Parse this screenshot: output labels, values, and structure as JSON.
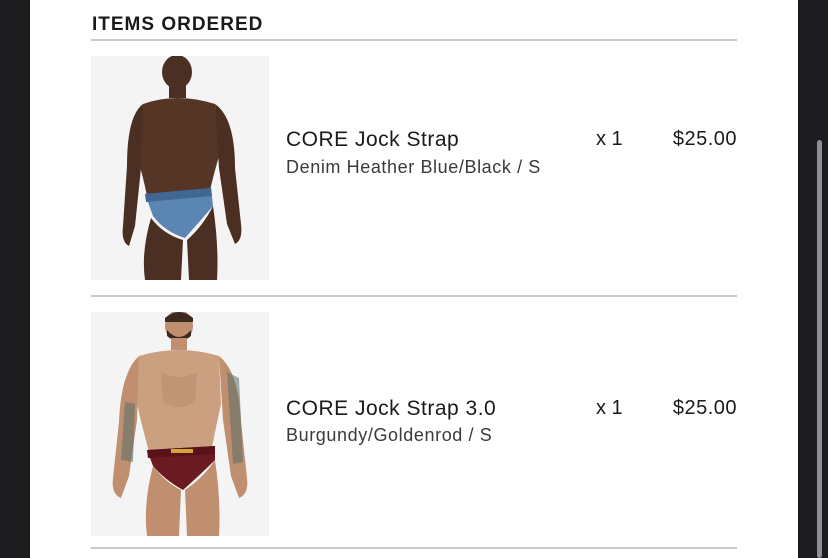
{
  "section": {
    "title": "ITEMS ORDERED"
  },
  "items": [
    {
      "name": "CORE Jock Strap",
      "variant": "Denim Heather Blue/Black / S",
      "quantity": "x 1",
      "price": "$25.00",
      "image_icon": "product-photo-model-blue-jock",
      "accent": "#5b86b4"
    },
    {
      "name": "CORE Jock Strap 3.0",
      "variant": "Burgundy/Goldenrod / S",
      "quantity": "x 1",
      "price": "$25.00",
      "image_icon": "product-photo-model-burgundy-jock",
      "accent": "#6b1a22"
    }
  ]
}
